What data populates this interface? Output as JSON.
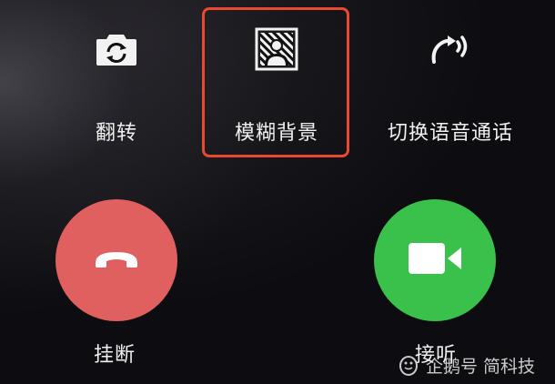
{
  "actions": {
    "flip": {
      "label": "翻转",
      "icon": "camera-flip-icon"
    },
    "blur_background": {
      "label": "模糊背景",
      "icon": "blur-portrait-icon"
    },
    "switch_voice": {
      "label": "切换语音通话",
      "icon": "voice-call-icon"
    }
  },
  "call": {
    "hangup": {
      "label": "挂断",
      "icon": "hang-up-phone-icon",
      "color": "#e06060"
    },
    "answer": {
      "label": "接听",
      "icon": "video-camera-icon",
      "color": "#39c14b"
    }
  },
  "highlight": {
    "color": "#e8492f",
    "target": "blur_background"
  },
  "watermark": {
    "text": "企鹅号 简科技"
  }
}
